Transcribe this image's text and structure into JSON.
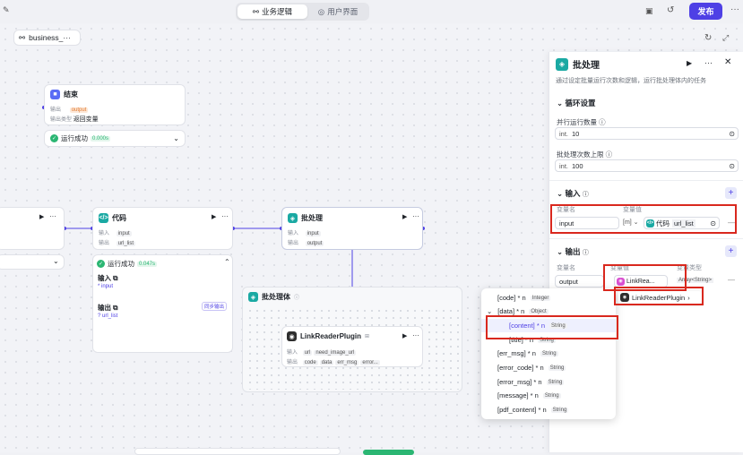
{
  "topbar": {
    "tab_logic": "业务逻辑",
    "tab_ui": "用户界面",
    "publish": "发布"
  },
  "canvas": {
    "breadcrumb": "business_···"
  },
  "end_node": {
    "title": "结束",
    "out_label": "输出",
    "out_value": "output",
    "type_label": "输出类型",
    "type_value": "返回变量",
    "status": "运行成功",
    "time": "0.000s"
  },
  "code_node": {
    "title": "代码",
    "in_label": "输入",
    "in_value": "input",
    "out_label": "输出",
    "out_value": "url_list",
    "status": "运行成功",
    "time": "0.047s",
    "section_in": "输入",
    "in_item": "* input",
    "section_out": "输出",
    "out_item": "? url_list",
    "sync_btn": "同步输出"
  },
  "batch_node": {
    "title": "批处理",
    "in_label": "输入",
    "in_value": "input",
    "out_label": "输出",
    "out_value": "output"
  },
  "batch_body": {
    "title": "批处理体"
  },
  "plugin_node": {
    "title": "LinkReaderPlugin",
    "in_label": "输入",
    "in_url": "url",
    "in_need": "need_image_url",
    "out_label": "输出",
    "out_code": "code",
    "out_data": "data",
    "out_err": "err_msg",
    "out_more": "error..."
  },
  "panel": {
    "title": "批处理",
    "desc": "通过设定批量运行次数和逻辑，运行批处理体内的任务",
    "loop_section": "循环设置",
    "concurrency_label": "并行运行数量",
    "concurrency_type": "int.",
    "concurrency_value": "10",
    "max_label": "批处理次数上限",
    "max_type": "int.",
    "max_value": "100",
    "input_section": "输入",
    "var_name_header": "变量名",
    "var_value_header": "变量值",
    "input_name": "input",
    "input_type": "[m]",
    "input_source": "代码",
    "input_ref": "url_list",
    "output_section": "输出",
    "out_name_header": "变量名",
    "out_value_header": "变量值",
    "out_type_header": "变量类型",
    "output_name": "output",
    "output_ref": "LinkRea...",
    "output_type": "Array<String>",
    "plugin_chip": "LinkReaderPlugin"
  },
  "dropdown": {
    "rows": [
      {
        "label": "[code] * n",
        "type": "Integer"
      },
      {
        "label": "[data] * n",
        "type": "Object"
      },
      {
        "label": "[content] * n",
        "type": "String"
      },
      {
        "label": "[title] * n",
        "type": "String"
      },
      {
        "label": "[err_msg] * n",
        "type": "String"
      },
      {
        "label": "[error_code] * n",
        "type": "String"
      },
      {
        "label": "[error_msg] * n",
        "type": "String"
      },
      {
        "label": "[message] * n",
        "type": "String"
      },
      {
        "label": "[pdf_content] * n",
        "type": "String"
      }
    ]
  },
  "colors": {
    "accent": "#4e40e5",
    "success": "#2bb673",
    "highlight": "#d9281e",
    "code_icon": "#1aa9a3"
  }
}
